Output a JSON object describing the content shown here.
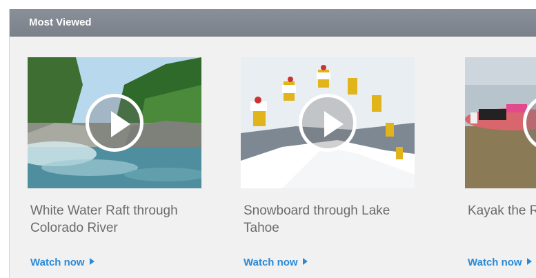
{
  "section": {
    "title": "Most Viewed"
  },
  "videos": [
    {
      "title": "White Water Raft through Colorado River",
      "cta": "Watch now"
    },
    {
      "title": "Snowboard through Lake Tahoe",
      "cta": "Watch now"
    },
    {
      "title": "Kayak the River",
      "cta": "Watch now"
    }
  ],
  "colors": {
    "header_bg": "#7e848d",
    "link": "#2a8ad6",
    "title_text": "#6b6b6b",
    "panel_bg": "#f1f1f1"
  }
}
